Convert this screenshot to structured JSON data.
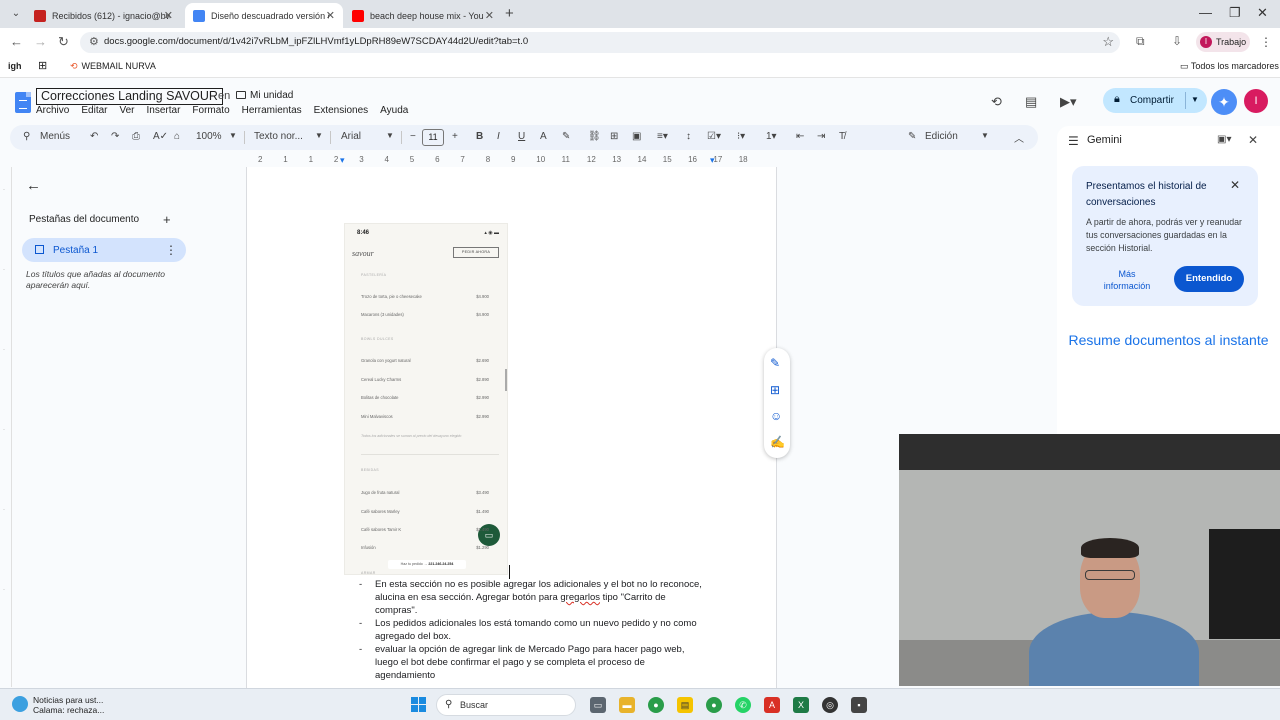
{
  "browser": {
    "tabs": [
      {
        "title": "Recibidos (612) - ignacio@bwin",
        "active": false,
        "favicon_color": "#c5221f"
      },
      {
        "title": "Diseño descuadrado versión co",
        "active": true,
        "favicon_color": "#4285f4"
      },
      {
        "title": "beach deep house mix - You",
        "active": false,
        "favicon_color": "#ff0000"
      }
    ],
    "url": "docs.google.com/document/d/1v42i7vRLbM_ipFZlLHVmf1yLDpRH89eW7SCDAY44d2U/edit?tab=t.0",
    "profile_label": "Trabajo",
    "profile_initial": "I",
    "bookmarks": {
      "left_label": "igh",
      "nurva": "WEBMAIL NURVA",
      "all": "Todos los marcadores"
    }
  },
  "docs": {
    "title": "Correcciones Landing SAVOUR",
    "location_prefix": "en",
    "location": "Mi unidad",
    "menus": [
      "Archivo",
      "Editar",
      "Ver",
      "Insertar",
      "Formato",
      "Herramientas",
      "Extensiones",
      "Ayuda"
    ],
    "share_label": "Compartir",
    "avatar_initial": "I",
    "accent_color": "#0b57d0"
  },
  "toolbar": {
    "menus_label": "Menús",
    "zoom": "100%",
    "style": "Texto nor...",
    "font": "Arial",
    "font_size": "11",
    "mode": "Edición"
  },
  "ruler": [
    "2",
    "1",
    "1",
    "2",
    "3",
    "4",
    "5",
    "6",
    "7",
    "8",
    "9",
    "10",
    "11",
    "12",
    "13",
    "14",
    "15",
    "16",
    "17",
    "18"
  ],
  "outline": {
    "heading": "Pestañas del documento",
    "tab_label": "Pestaña 1",
    "hint": "Los títulos que añadas al documento aparecerán aquí."
  },
  "phone": {
    "time": "8:46",
    "brand": "savour",
    "order_btn": "PEDIR AHORA",
    "sections": [
      "PASTELERÍA",
      "BOWLS DULCES",
      "BEBIDAS",
      "ARMAR"
    ],
    "items": [
      {
        "name": "Trozo de torta, pie o cheesecake",
        "price": "$4.900"
      },
      {
        "name": "Macarons (3 unidades)",
        "price": "$4.900"
      },
      {
        "name": "Granola con yogurt natural",
        "price": "$2.690"
      },
      {
        "name": "Cereal Lucky Charms",
        "price": "$2.890"
      },
      {
        "name": "Bolitas de chocolate",
        "price": "$2.990"
      },
      {
        "name": "Mini Malvaviscos",
        "price": "$2.990"
      },
      {
        "name": "Jugo de fruta natural",
        "price": "$3.490"
      },
      {
        "name": "Café sabores Marley",
        "price": "$1.490"
      },
      {
        "name": "Café sabores Tamir K",
        "price": "$1.490"
      },
      {
        "name": "Infusión",
        "price": "$1.290"
      }
    ],
    "note": "Todos los adicionales se suman al precio del desayuno elegido",
    "whatsapp_prefix": "Haz tu pedido →",
    "whatsapp_number": "221.246.24.254"
  },
  "notes": {
    "item1_a": "En esta sección no es posible agregar los adicionales y el bot no lo reconoce, alucina en esa sección. Agregar botón para ",
    "item1_ul": "gregarlos",
    "item1_b": " tipo \"Carrito de compras\".",
    "item2": "Los pedidos adicionales los está tomando como un nuevo pedido y no como agregado del box.",
    "item3": "evaluar la opción de agregar link de Mercado Pago para hacer pago web, luego el bot debe confirmar el pago y se completa el proceso de agendamiento"
  },
  "gemini": {
    "title": "Gemini",
    "card_title": "Presentamos el historial de conversaciones",
    "card_body": "A partir de ahora, podrás ver y reanudar tus conversaciones guardadas en la sección Historial.",
    "more": "Más información",
    "ok": "Entendido",
    "summary": "Resume documentos al instante"
  },
  "taskbar": {
    "news_line1": "Noticias para ust...",
    "news_line2": "Calama: rechaza...",
    "search": "Buscar"
  }
}
